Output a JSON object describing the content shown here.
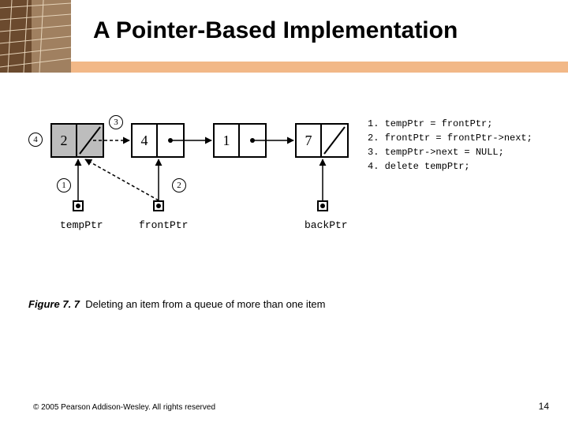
{
  "title": "A Pointer-Based Implementation",
  "nodes": [
    {
      "value": "2",
      "gray": true
    },
    {
      "value": "4",
      "gray": false
    },
    {
      "value": "1",
      "gray": false
    },
    {
      "value": "7",
      "gray": false
    }
  ],
  "pointers": {
    "temp": "tempPtr",
    "front": "frontPtr",
    "back": "backPtr"
  },
  "steps": {
    "one": "1",
    "two": "2",
    "three": "3",
    "four": "4"
  },
  "code": [
    "1. tempPtr = frontPtr;",
    "2. frontPtr = frontPtr->next;",
    "3. tempPtr->next = NULL;",
    "4. delete tempPtr;"
  ],
  "caption_bold": "Figure 7. 7",
  "caption_text": "Deleting an item from a queue of more than one item",
  "copyright": "© 2005 Pearson Addison-Wesley. All rights reserved",
  "pagenum": "14"
}
